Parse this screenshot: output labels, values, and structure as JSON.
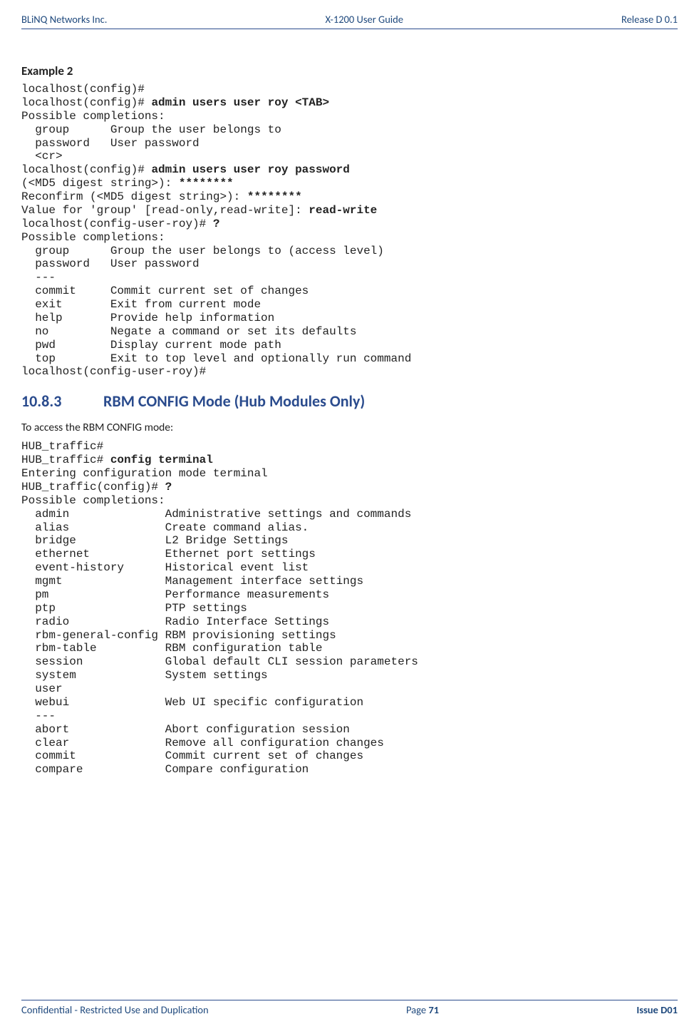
{
  "header": {
    "left": "BLiNQ Networks Inc.",
    "center": "X-1200 User Guide",
    "right": "Release D 0.1"
  },
  "example": {
    "title": "Example 2",
    "block1": {
      "l1": "localhost(config)#",
      "l2a": "localhost(config)# ",
      "l2b": "admin users user roy <TAB>",
      "l3": "Possible completions:",
      "l4": "  group      Group the user belongs to",
      "l5": "  password   User password",
      "l6": "  <cr>",
      "l7a": "localhost(config)# ",
      "l7b": "admin users user roy password",
      "l8a": "(<MD5 digest string>): ",
      "l8b": "********",
      "l9a": "Reconfirm (<MD5 digest string>): ",
      "l9b": "********",
      "l10a": "Value for 'group' [read-only,read-write]: ",
      "l10b": "read-write",
      "l11a": "localhost(config-user-roy)# ",
      "l11b": "?",
      "l12": "Possible completions:",
      "l13": "  group      Group the user belongs to (access level)",
      "l14": "  password   User password",
      "l15": "  ---",
      "l16": "  commit     Commit current set of changes",
      "l17": "  exit       Exit from current mode",
      "l18": "  help       Provide help information",
      "l19": "  no         Negate a command or set its defaults",
      "l20": "  pwd        Display current mode path",
      "l21": "  top        Exit to top level and optionally run command",
      "l22": "localhost(config-user-roy)#"
    }
  },
  "section": {
    "number": "10.8.3",
    "title": "RBM CONFIG Mode (Hub Modules Only)",
    "intro": "To access the RBM CONFIG mode:",
    "block2": {
      "l1": "HUB_traffic#",
      "l2a": "HUB_traffic# ",
      "l2b": "config terminal",
      "l3": "Entering configuration mode terminal",
      "l4a": "HUB_traffic(config)# ",
      "l4b": "?",
      "l5": "Possible completions:",
      "l6": "  admin              Administrative settings and commands",
      "l7": "  alias              Create command alias.",
      "l8": "  bridge             L2 Bridge Settings",
      "l9": "  ethernet           Ethernet port settings",
      "l10": "  event-history      Historical event list",
      "l11": "  mgmt               Management interface settings",
      "l12": "  pm                 Performance measurements",
      "l13": "  ptp                PTP settings",
      "l14": "  radio              Radio Interface Settings",
      "l15": "  rbm-general-config RBM provisioning settings",
      "l16": "  rbm-table          RBM configuration table",
      "l17": "  session            Global default CLI session parameters",
      "l18": "  system             System settings",
      "l19": "  user",
      "l20": "  webui              Web UI specific configuration",
      "l21": "  ---",
      "l22": "  abort              Abort configuration session",
      "l23": "  clear              Remove all configuration changes",
      "l24": "  commit             Commit current set of changes",
      "l25": "  compare            Compare configuration"
    }
  },
  "footer": {
    "left": "Confidential - Restricted Use and Duplication",
    "center_prefix": "Page ",
    "center_num": "71",
    "right": "Issue D01"
  }
}
